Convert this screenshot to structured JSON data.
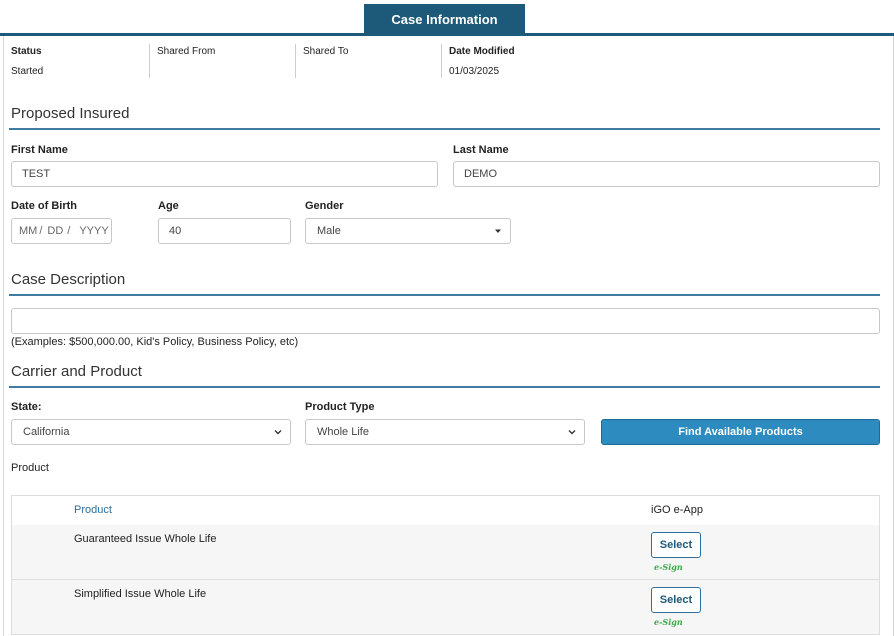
{
  "tab": {
    "title": "Case Information"
  },
  "status_bar": {
    "status_label": "Status",
    "status_value": "Started",
    "shared_from_label": "Shared From",
    "shared_to_label": "Shared To",
    "date_modified_label": "Date Modified",
    "date_modified_value": "01/03/2025"
  },
  "proposed_insured": {
    "title": "Proposed Insured",
    "first_name_label": "First Name",
    "first_name_value": "TEST",
    "last_name_label": "Last Name",
    "last_name_value": "DEMO",
    "dob_label": "Date of Birth",
    "dob_mm": "MM",
    "dob_dd": "DD",
    "dob_yyyy": "YYYY",
    "dob_sep": "/",
    "age_label": "Age",
    "age_value": "40",
    "gender_label": "Gender",
    "gender_value": "Male"
  },
  "case_description": {
    "title": "Case Description",
    "value": "",
    "helper": "(Examples: $500,000.00, Kid's Policy, Business Policy, etc)"
  },
  "carrier_product": {
    "title": "Carrier and Product",
    "state_label": "State:",
    "state_value": "California",
    "product_type_label": "Product Type",
    "product_type_value": "Whole Life",
    "find_button": "Find Available Products",
    "product_label": "Product"
  },
  "product_table": {
    "col_product": "Product",
    "col_igo": "iGO e-App",
    "rows": [
      {
        "name": "Guaranteed Issue Whole Life",
        "button": "Select",
        "tag": "e-Sign"
      },
      {
        "name": "Simplified Issue Whole Life",
        "button": "Select",
        "tag": "e-Sign"
      }
    ]
  },
  "colors": {
    "primary": "#1d5a7a",
    "button_blue": "#2e8bc0",
    "esign_green": "#3aa84a"
  }
}
